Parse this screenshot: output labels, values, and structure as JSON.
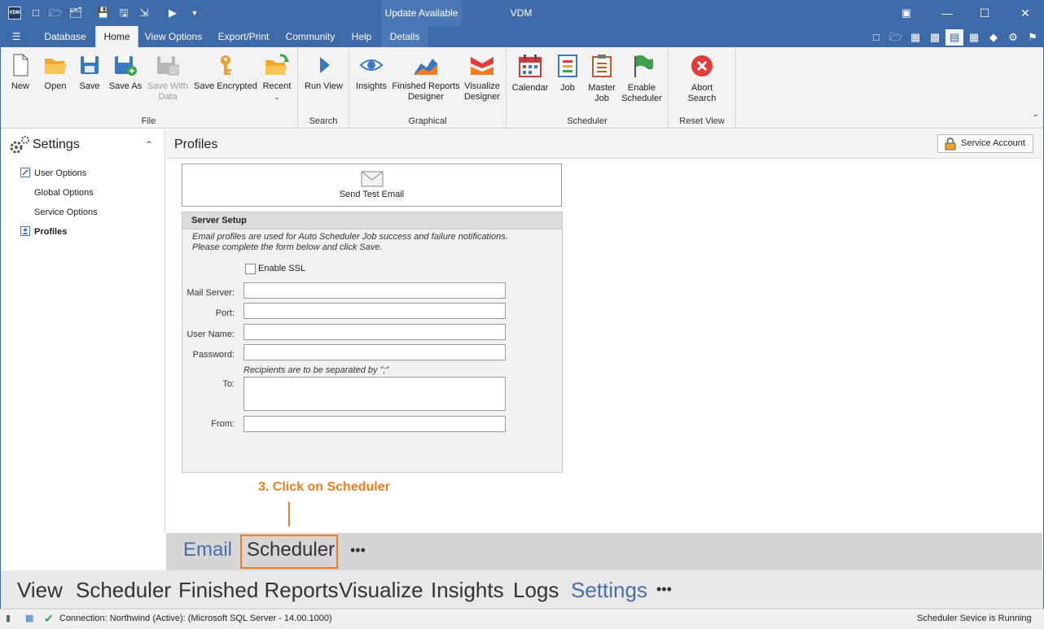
{
  "window": {
    "title": "VDM",
    "logo_text": "VDM",
    "update_tab": "Update Available"
  },
  "menu": {
    "tabs": [
      "Database",
      "Home",
      "View Options",
      "Export/Print",
      "Community",
      "Help",
      "Details"
    ],
    "active": "Home"
  },
  "ribbon": {
    "file": {
      "label": "File",
      "new": "New",
      "open": "Open",
      "save": "Save",
      "save_as": "Save As",
      "save_with_data_1": "Save With",
      "save_with_data_2": "Data",
      "save_encrypted": "Save Encrypted",
      "recent": "Recent"
    },
    "search": {
      "label": "Search",
      "run_view": "Run View"
    },
    "graphical": {
      "label": "Graphical",
      "insights": "Insights",
      "frd_1": "Finished Reports",
      "frd_2": "Designer",
      "vis_1": "Visualize",
      "vis_2": "Designer"
    },
    "scheduler": {
      "label": "Scheduler",
      "calendar": "Calendar",
      "job": "Job",
      "master_1": "Master",
      "master_2": "Job",
      "enable_1": "Enable",
      "enable_2": "Scheduler"
    },
    "reset": {
      "label": "Reset View",
      "abort_1": "Abort",
      "abort_2": "Search"
    }
  },
  "settings_nav": {
    "title": "Settings",
    "items": [
      "User Options",
      "Global Options",
      "Service Options",
      "Profiles"
    ],
    "selected": "Profiles"
  },
  "content": {
    "title": "Profiles",
    "service_account": "Service Account",
    "send_test_email": "Send Test Email",
    "server_setup": {
      "heading": "Server Setup",
      "note_line1": "Email profiles are used for Auto Scheduler Job success and failure notifications.",
      "note_line2": "Please complete the form below and click Save.",
      "enable_ssl": "Enable SSL",
      "mail_server": "Mail Server:",
      "port": "Port:",
      "user_name": "User Name:",
      "password": "Password:",
      "recipients_note": "Recipients are to be separated by \";\"",
      "to": "To:",
      "from": "From:"
    }
  },
  "callout": {
    "text": "3. Click on Scheduler"
  },
  "subtabs": {
    "items": [
      "Email",
      "Scheduler",
      "•••"
    ],
    "highlighted": "Scheduler"
  },
  "modules": {
    "items": [
      "View",
      "Scheduler",
      "Finished Reports",
      "Visualize",
      "Insights",
      "Logs",
      "Settings",
      "•••"
    ],
    "active": "Settings"
  },
  "status": {
    "connection": "Connection: Northwind (Active): (Microsoft SQL Server - 14.00.1000)",
    "service": "Scheduler Sevice is Running"
  },
  "colors": {
    "accent": "#3d6aa8",
    "callout": "#f07c22",
    "active_module": "#4a6ea8"
  }
}
